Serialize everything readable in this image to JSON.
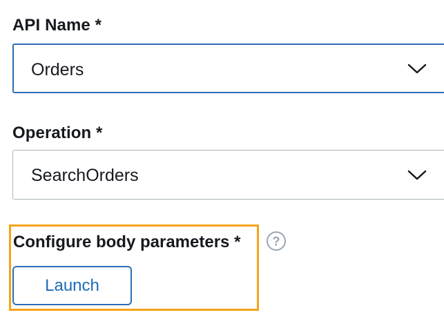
{
  "api_field": {
    "label": "API Name *",
    "selected": "Orders"
  },
  "operation_field": {
    "label": "Operation *",
    "selected": "SearchOrders"
  },
  "body_params": {
    "label": "Configure body parameters *",
    "help_icon": "question-circle-icon",
    "launch_label": "Launch"
  },
  "colors": {
    "highlight_border": "#f7a318",
    "focus_border": "#2d6db5",
    "button_text": "#1d6bb5",
    "default_border": "#aab7b8",
    "help_icon": "#9aa6b2"
  },
  "icons": {
    "dropdown": "chevron-down-icon"
  }
}
